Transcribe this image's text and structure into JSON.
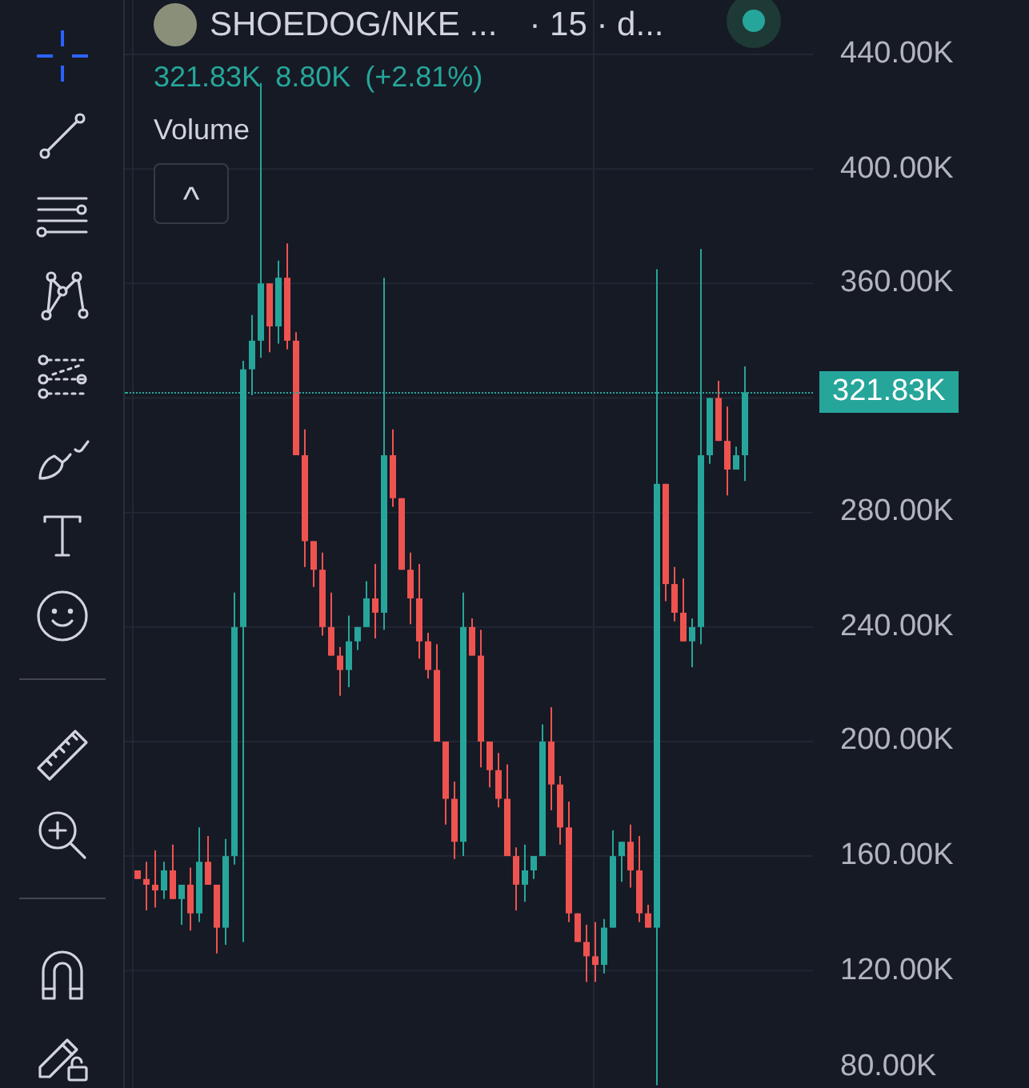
{
  "toolbar": {
    "tools": [
      {
        "kind": "crosshair",
        "selected": true
      },
      {
        "kind": "trend-line",
        "selected": false
      },
      {
        "kind": "horizontal-lines",
        "selected": false
      },
      {
        "kind": "pattern",
        "selected": false
      },
      {
        "kind": "forecast",
        "selected": false
      },
      {
        "kind": "brush",
        "selected": false
      },
      {
        "kind": "text",
        "selected": false
      },
      {
        "kind": "emoji",
        "selected": false
      },
      {
        "kind": "divider",
        "selected": false
      },
      {
        "kind": "ruler",
        "selected": false
      },
      {
        "kind": "zoom",
        "selected": false
      },
      {
        "kind": "divider",
        "selected": false
      },
      {
        "kind": "magnet",
        "selected": false
      },
      {
        "kind": "lock-drawing",
        "selected": false
      }
    ]
  },
  "header": {
    "symbol": "SHOEDOG/NKE ...",
    "interval": "· 15 · d...",
    "live": true,
    "price": "321.83K",
    "change": "8.80K",
    "change_pct": "(+2.81%)",
    "indicator": "Volume",
    "collapse": "^"
  },
  "chart": {
    "bottom_label": "80.00K",
    "price_label": "321.83K",
    "chart_data": {
      "type": "candlestick",
      "ylim": [
        79,
        459
      ],
      "grid": true,
      "yticks": [
        {
          "value": 440,
          "label": "440.00K"
        },
        {
          "value": 400,
          "label": "400.00K"
        },
        {
          "value": 360,
          "label": "360.00K"
        },
        {
          "value": 280,
          "label": "280.00K"
        },
        {
          "value": 240,
          "label": "240.00K"
        },
        {
          "value": 200,
          "label": "200.00K"
        },
        {
          "value": 160,
          "label": "160.00K"
        },
        {
          "value": 120,
          "label": "120.00K"
        }
      ],
      "ohlc": [
        [
          155,
          155,
          152,
          152
        ],
        [
          152,
          158,
          141,
          150
        ],
        [
          150,
          162,
          142,
          148
        ],
        [
          148,
          158,
          145,
          155
        ],
        [
          155,
          164,
          145,
          145
        ],
        [
          145,
          150,
          136,
          150
        ],
        [
          150,
          156,
          134,
          140
        ],
        [
          140,
          170,
          137,
          158
        ],
        [
          158,
          167,
          150,
          150
        ],
        [
          150,
          150,
          126,
          135
        ],
        [
          135,
          166,
          129,
          160
        ],
        [
          160,
          252,
          157,
          240
        ],
        [
          240,
          333,
          130,
          330
        ],
        [
          330,
          349,
          321,
          340
        ],
        [
          340,
          430,
          334,
          360
        ],
        [
          360,
          360,
          336,
          345
        ],
        [
          345,
          368,
          339,
          362
        ],
        [
          362,
          374,
          337,
          340
        ],
        [
          340,
          343,
          300,
          300
        ],
        [
          300,
          309,
          261,
          270
        ],
        [
          270,
          270,
          254,
          260
        ],
        [
          260,
          266,
          237,
          240
        ],
        [
          240,
          252,
          230,
          230
        ],
        [
          230,
          233,
          216,
          225
        ],
        [
          225,
          244,
          219,
          235
        ],
        [
          235,
          240,
          232,
          240
        ],
        [
          240,
          256,
          240,
          250
        ],
        [
          250,
          262,
          236,
          245
        ],
        [
          245,
          362,
          239,
          300
        ],
        [
          300,
          309,
          282,
          285
        ],
        [
          285,
          285,
          260,
          260
        ],
        [
          260,
          266,
          241,
          250
        ],
        [
          250,
          262,
          229,
          235
        ],
        [
          235,
          238,
          222,
          225
        ],
        [
          225,
          234,
          200,
          200
        ],
        [
          200,
          200,
          171,
          180
        ],
        [
          180,
          186,
          159,
          165
        ],
        [
          165,
          252,
          160,
          240
        ],
        [
          240,
          243,
          230,
          230
        ],
        [
          230,
          239,
          191,
          200
        ],
        [
          200,
          200,
          184,
          190
        ],
        [
          190,
          196,
          177,
          180
        ],
        [
          180,
          192,
          160,
          160
        ],
        [
          160,
          163,
          141,
          150
        ],
        [
          150,
          164,
          144,
          155
        ],
        [
          155,
          160,
          152,
          160
        ],
        [
          160,
          206,
          160,
          200
        ],
        [
          200,
          212,
          176,
          185
        ],
        [
          185,
          188,
          164,
          170
        ],
        [
          170,
          179,
          137,
          140
        ],
        [
          140,
          140,
          130,
          130
        ],
        [
          130,
          136,
          116,
          125
        ],
        [
          125,
          137,
          116,
          122
        ],
        [
          122,
          138,
          119,
          135
        ],
        [
          135,
          169,
          135,
          160
        ],
        [
          160,
          165,
          151,
          165
        ],
        [
          165,
          171,
          149,
          155
        ],
        [
          155,
          167,
          137,
          140
        ],
        [
          140,
          143,
          135,
          135
        ],
        [
          135,
          365,
          80,
          290
        ],
        [
          290,
          290,
          249,
          255
        ],
        [
          255,
          261,
          242,
          245
        ],
        [
          245,
          257,
          235,
          235
        ],
        [
          235,
          243,
          226,
          240
        ],
        [
          240,
          372,
          234,
          300
        ],
        [
          300,
          320,
          297,
          320
        ],
        [
          320,
          326,
          305,
          305
        ],
        [
          305,
          317,
          286,
          295
        ],
        [
          295,
          303,
          295,
          300
        ],
        [
          300,
          331,
          291,
          322
        ]
      ]
    }
  }
}
